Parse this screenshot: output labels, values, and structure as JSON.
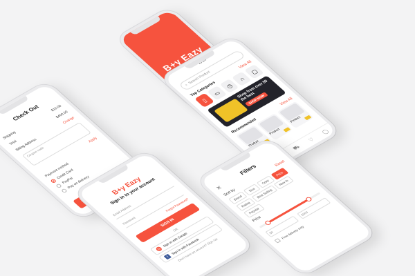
{
  "splash": {
    "logo": "B+y Eazy"
  },
  "home": {
    "time": "10:24",
    "search_placeholder": "Search Product",
    "categories_title": "Top Categories",
    "view_all": "View All",
    "categories": [
      "phone-icon",
      "laptop-icon",
      "watch-icon",
      "headphones-icon",
      "tablet-icon"
    ],
    "banner_text": "Shop from over 50 the best",
    "banner_cta": "SHOP NOW",
    "recommended_title": "Recommended",
    "products": [
      "Product",
      "Product",
      "Product"
    ],
    "tabs": [
      "home-icon",
      "grid-icon",
      "cart-icon",
      "heart-icon",
      "user-icon"
    ]
  },
  "checkout": {
    "title": "Check Out",
    "shipping_label": "Shipping",
    "shipping_value": "$10.00",
    "total_label": "Total",
    "total_value": "$400.00",
    "change": "Change",
    "address_label": "Billing Address",
    "coupon_placeholder": "Coupon code",
    "apply": "Apply",
    "payment_title": "Payment method",
    "payments": [
      "Credit Card",
      "PayPal",
      "Pay on delivery"
    ],
    "button": "NEXT"
  },
  "signin": {
    "brand": "B+y Eazy",
    "subtitle": "Sign in to your account",
    "email_placeholder": "Email Address",
    "password_placeholder": "Password",
    "forgot": "Forgot Password?",
    "button": "SIGN IN",
    "or": "OR",
    "google": "Sign in with Google",
    "facebook": "Sign in with Facebook",
    "note": "Don't have an account? Sign Up"
  },
  "filters": {
    "title": "Filters",
    "reset": "Reset",
    "sort_label": "Sort by",
    "chips": [
      "Brand",
      "Size",
      "Color",
      "Price",
      "Rating",
      "Best Selling",
      "New In",
      "Popular"
    ],
    "active_chip": "Price",
    "price_label": "Price",
    "min": "$0",
    "max": "$500",
    "check": "Free delivery only",
    "range": {
      "low": 0.1,
      "high": 0.85
    }
  }
}
